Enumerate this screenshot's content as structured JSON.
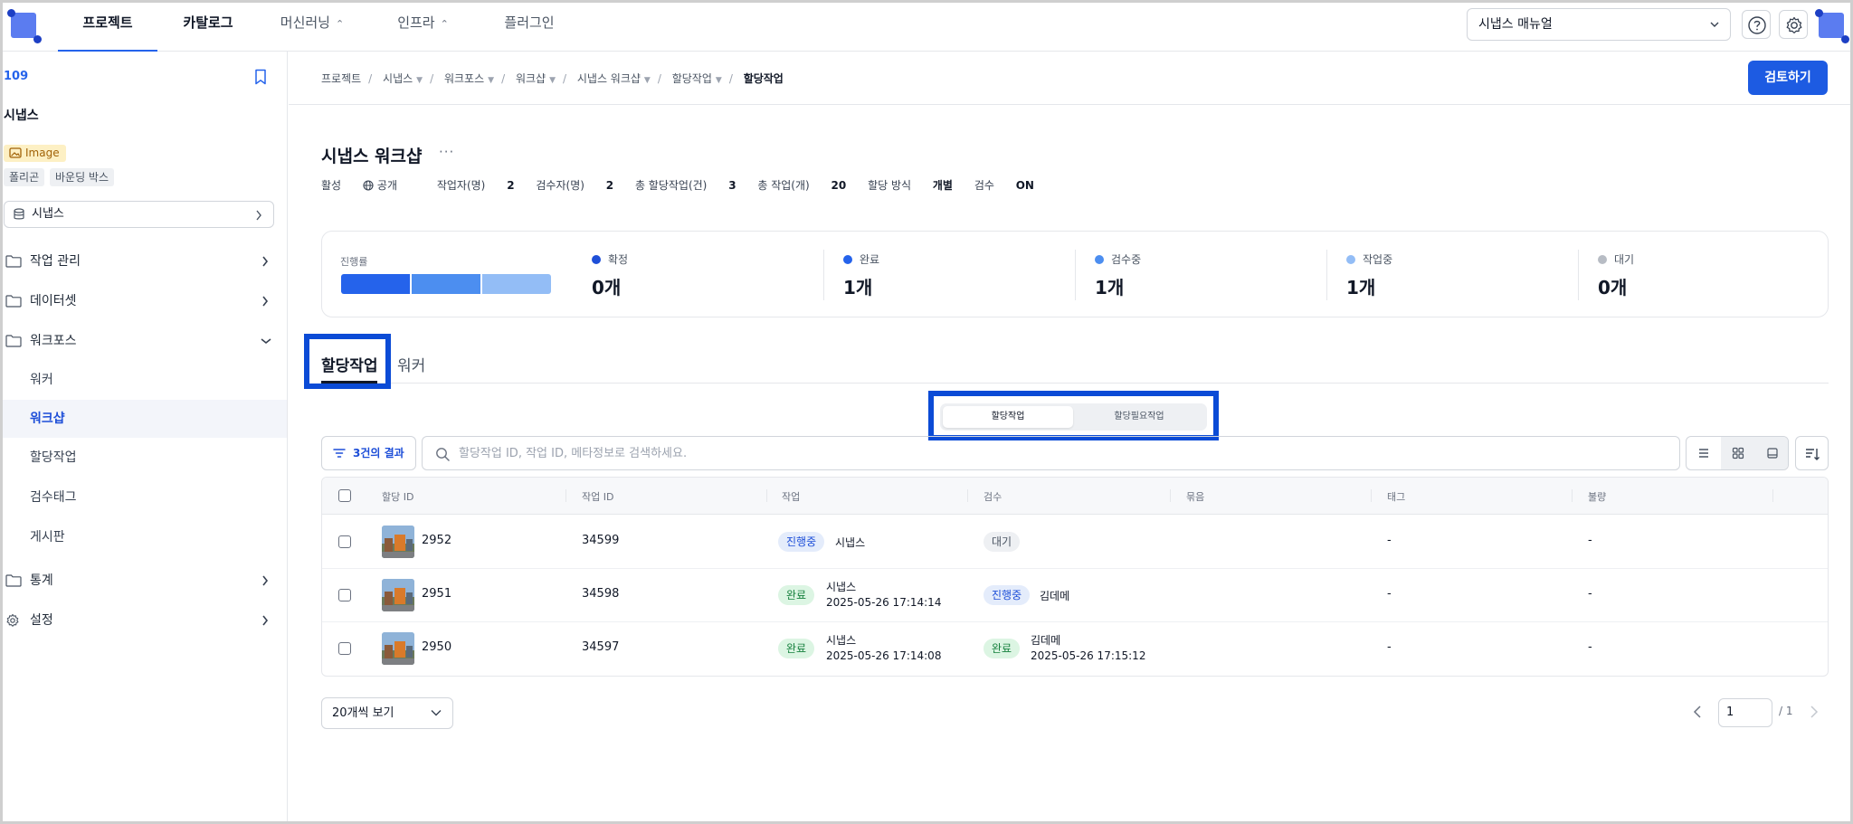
{
  "nav": {
    "items": [
      {
        "label": "프로젝트"
      },
      {
        "label": "카탈로그"
      },
      {
        "label": "머신러닝"
      },
      {
        "label": "인프라"
      },
      {
        "label": "플러그인"
      }
    ],
    "manual_select": "시냅스 매뉴얼"
  },
  "sidebar": {
    "project_id": "109",
    "project_name": "시냅스",
    "data_type_tag": "Image",
    "annotation_tags": [
      "폴리곤",
      "바운딩 박스"
    ],
    "dataset_select": "시냅스",
    "menu": [
      {
        "label": "작업 관리"
      },
      {
        "label": "데이터셋"
      },
      {
        "label": "워크포스"
      },
      {
        "label": "통계"
      },
      {
        "label": "설정"
      }
    ],
    "workforce_items": [
      {
        "label": "워커"
      },
      {
        "label": "워크샵"
      },
      {
        "label": "할당작업"
      },
      {
        "label": "검수태그"
      },
      {
        "label": "게시판"
      }
    ]
  },
  "breadcrumb": [
    "프로젝트",
    "시냅스",
    "워크포스",
    "워크샵",
    "시냅스 워크샵",
    "할당작업",
    "할당작업"
  ],
  "review_button": "검토하기",
  "workshop": {
    "title": "시냅스 워크샵",
    "more": "···",
    "meta": {
      "active": "활성",
      "visibility": "공개",
      "workers_label": "작업자(명)",
      "workers_value": "2",
      "reviewers_label": "검수자(명)",
      "reviewers_value": "2",
      "assignments_label": "총 할당작업(건)",
      "assignments_value": "3",
      "tasks_label": "총 작업(개)",
      "tasks_value": "20",
      "method_label": "할당 방식",
      "method_value": "개별",
      "review_label": "검수",
      "review_value": "ON"
    }
  },
  "progress": {
    "label": "진행률",
    "stats": [
      {
        "label": "확정",
        "value": "0개",
        "color": "#1e4fd8"
      },
      {
        "label": "완료",
        "value": "1개",
        "color": "#2563eb"
      },
      {
        "label": "검수중",
        "value": "1개",
        "color": "#4c8ef0"
      },
      {
        "label": "작업중",
        "value": "1개",
        "color": "#93bdf6"
      },
      {
        "label": "대기",
        "value": "0개",
        "color": "#b7bcc4"
      }
    ]
  },
  "tabs": [
    "할당작업",
    "워커"
  ],
  "segment": [
    "할당작업",
    "할당필요작업"
  ],
  "toolbar": {
    "result_count": "3건의 결과",
    "search_placeholder": "할당작업 ID, 작업 ID, 메타정보로 검색하세요."
  },
  "table": {
    "headers": [
      "할당 ID",
      "작업 ID",
      "작업",
      "검수",
      "묶음",
      "태그",
      "불량"
    ],
    "rows": [
      {
        "assign_id": "2952",
        "task_id": "34599",
        "work_status": "진행중",
        "work_name": "시냅스",
        "work_time": "",
        "review_status": "대기",
        "review_name": "",
        "review_time": "",
        "bundle": "",
        "tag": "-",
        "defect": "-"
      },
      {
        "assign_id": "2951",
        "task_id": "34598",
        "work_status": "완료",
        "work_name": "시냅스",
        "work_time": "2025-05-26 17:14:14",
        "review_status": "진행중",
        "review_name": "김데메",
        "review_time": "",
        "bundle": "",
        "tag": "-",
        "defect": "-"
      },
      {
        "assign_id": "2950",
        "task_id": "34597",
        "work_status": "완료",
        "work_name": "시냅스",
        "work_time": "2025-05-26 17:14:08",
        "review_status": "완료",
        "review_name": "김데메",
        "review_time": "2025-05-26 17:15:12",
        "bundle": "",
        "tag": "-",
        "defect": "-"
      }
    ]
  },
  "pagination": {
    "page_size": "20개씩 보기",
    "current_page": "1",
    "total": "/ 1"
  }
}
